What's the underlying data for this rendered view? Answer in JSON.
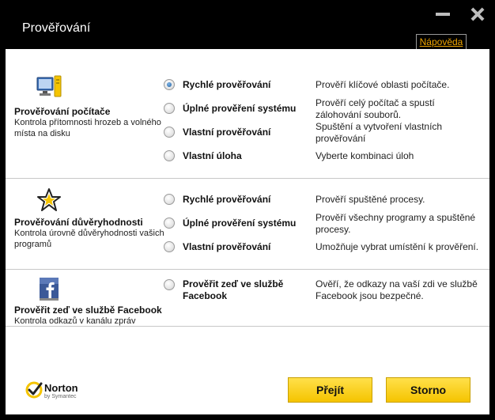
{
  "window": {
    "title": "Prověřování"
  },
  "help": {
    "label": "Nápověda"
  },
  "sections": [
    {
      "title": "Prověřování počítače",
      "description": "Kontrola přítomnosti hrozeb a volného místa na disku",
      "icon": "computer-icon",
      "options": [
        {
          "label": "Rychlé prověřování",
          "description": "Prověří klíčové oblasti počítače.",
          "checked": true
        },
        {
          "label": "Úplné prověření systému",
          "description": "Prověří celý počítač a spustí zálohování souborů."
        },
        {
          "label": "Vlastní prověřování",
          "description": "Spuštění a vytvoření vlastních prověřování"
        },
        {
          "label": "Vlastní úloha",
          "description": "Vyberte kombinaci úloh"
        }
      ]
    },
    {
      "title": "Prověřování důvěryhodnosti",
      "description": "Kontrola úrovně důvěryhodnosti vašich programů",
      "icon": "trust-star-icon",
      "options": [
        {
          "label": "Rychlé prověřování",
          "description": "Prověří spuštěné procesy."
        },
        {
          "label": "Úplné prověření systému",
          "description": "Prověří všechny programy a spuštěné procesy."
        },
        {
          "label": "Vlastní prověřování",
          "description": "Umožňuje vybrat umístění k prověření."
        }
      ]
    },
    {
      "title": "Prověřit zeď ve službě Facebook",
      "description": "Kontrola odkazů v kanálu zpráv",
      "icon": "facebook-icon",
      "options": [
        {
          "label": "Prověřit zeď ve službě Facebook",
          "description": "Ověří, že odkazy na vaší zdi ve službě Facebook jsou bezpečné."
        }
      ]
    }
  ],
  "footer": {
    "logo": {
      "name": "Norton",
      "sub": "by Symantec"
    },
    "go_label": "Přejít",
    "cancel_label": "Storno"
  },
  "colors": {
    "accent": "#f5c400",
    "link": "#f0a500",
    "titlebar": "#000000"
  }
}
